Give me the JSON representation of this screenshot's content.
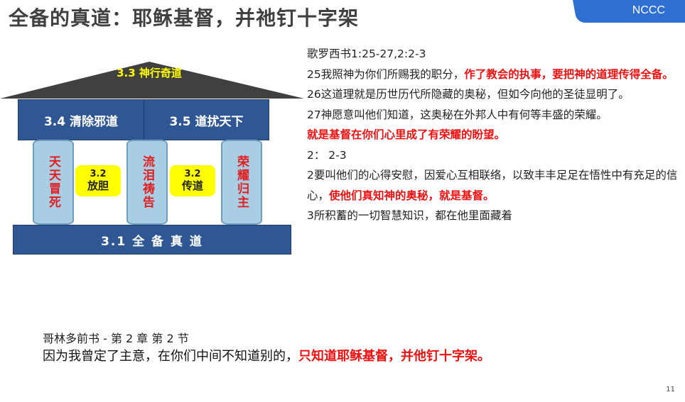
{
  "title": "全备的真道：耶稣基督，并祂钉十字架",
  "brand": {
    "label": "NCCC",
    "color": "#2e6fd1"
  },
  "house": {
    "roof": "3.3 神行奇道",
    "beam_left": "3.4 清除邪道",
    "beam_right": "3.5 道扰天下",
    "pillars": [
      "天天冒死",
      "流泪祷告",
      "荣耀归主"
    ],
    "middle_labels": [
      {
        "number": "3.2",
        "text": "放胆"
      },
      {
        "number": "3.2",
        "text": "传道"
      }
    ],
    "base": "3.1 全 备 真 道"
  },
  "passage": {
    "reference": "歌罗西书1:25-27,2:2-3",
    "v25_plain": "25我照神为你们所赐我的职分，",
    "v25_red": "作了教会的执事，要把神的道理传得全备。",
    "v26": "26这道理就是历世历代所隐藏的奥秘，但如今向他的圣徒显明了。",
    "v27_plain": "27神愿意叫他们知道，这奥秘在外邦人中有何等丰盛的荣耀。",
    "v27_red": "就是基督在你们心里成了有荣耀的盼望。",
    "ch2_ref": "2：  2-3",
    "v2_plain": "2要叫他们的心得安慰，因爱心互相联络，以致丰丰足足在悟性中有充足的信心，",
    "v2_red": "使他们真知神的奥秘，就是基督。",
    "v3": "3所积蓄的一切智慧知识，都在他里面藏着"
  },
  "corinthians": {
    "reference": "哥林多前书 - 第 2 章 第 2 节",
    "text_plain": "因为我曾定了主意，在你们中间不知道别的，",
    "text_red": "只知道耶稣基督，并他钉十字架。"
  },
  "page_number": "11"
}
